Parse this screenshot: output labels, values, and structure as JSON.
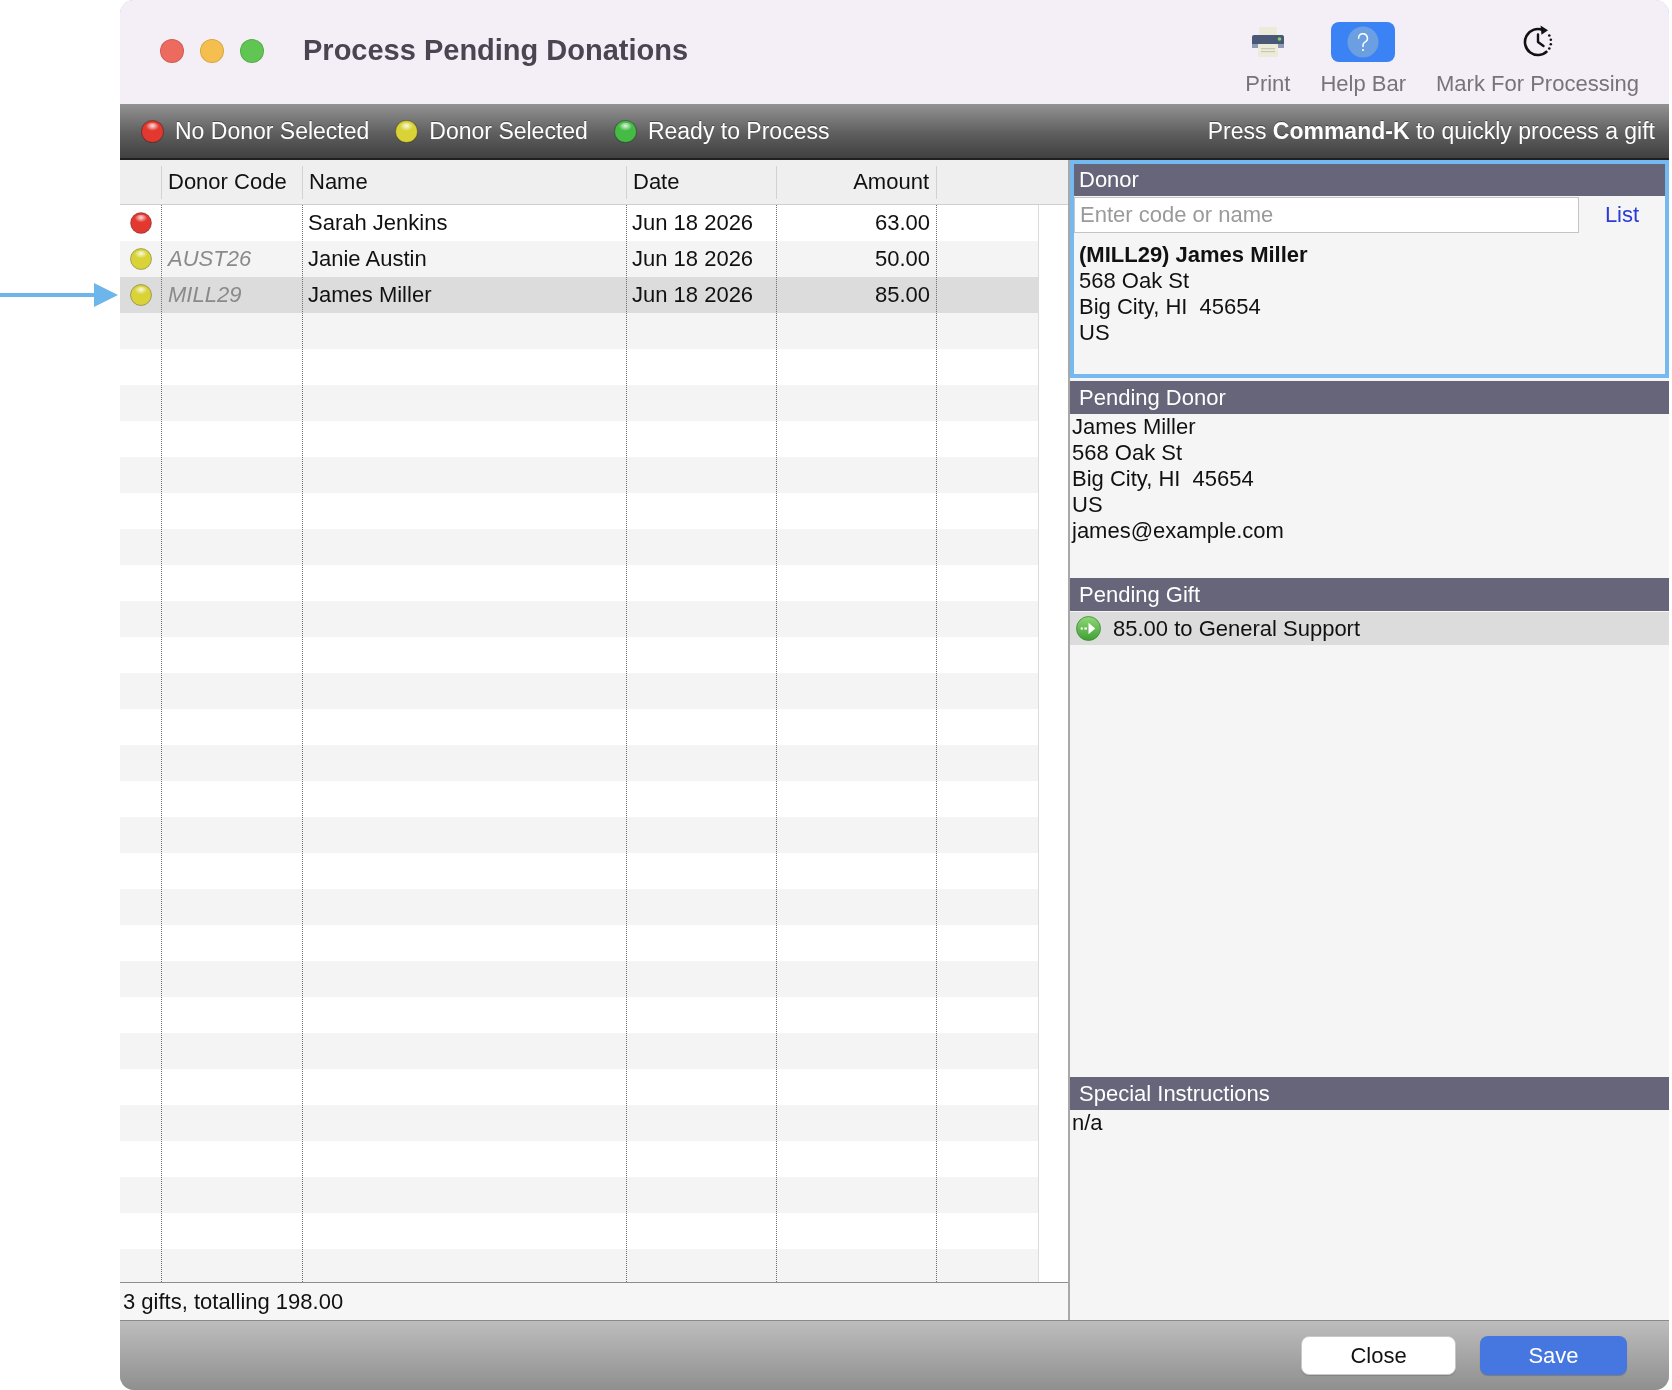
{
  "window": {
    "title": "Process Pending Donations"
  },
  "toolbar": [
    {
      "kind": "print",
      "label": "Print",
      "on": false
    },
    {
      "kind": "help",
      "label": "Help Bar",
      "on": true
    },
    {
      "kind": "clock",
      "label": "Mark For Processing",
      "on": false
    }
  ],
  "legend": {
    "items": [
      {
        "label": "No Donor Selected",
        "color": "#e2382f"
      },
      {
        "label": "Donor Selected",
        "color": "#d9d338"
      },
      {
        "label": "Ready to Process",
        "color": "#45bb45"
      }
    ],
    "hint": "Press **Command-K** to quickly process a gift"
  },
  "table": {
    "columns": [
      "Donor Code",
      "Name",
      "Date",
      "Amount"
    ],
    "rows": [
      {
        "color": "#e2382f",
        "name": "Sarah Jenkins",
        "date": "Jun 18 2026",
        "amount": "63.00",
        "selected": false
      },
      {
        "color": "#d9d338",
        "donor_code": "AUST26",
        "name": "Janie Austin",
        "date": "Jun 18 2026",
        "amount": "50.00",
        "selected": false
      },
      {
        "color": "#d9d338",
        "donor_code": "MILL29",
        "name": "James Miller",
        "date": "Jun 18 2026",
        "amount": "85.00",
        "selected": true
      }
    ],
    "summary": "3 gifts, totalling 198.00"
  },
  "donor": {
    "title": "Donor",
    "focused": true,
    "search": {
      "placeholder": "Enter code or name"
    },
    "list_link": "List",
    "match": {
      "heading": "(MILL29) James Miller",
      "lines": [
        "568 Oak St",
        "Big City, HI  45654",
        "US"
      ]
    }
  },
  "pending_donor": {
    "title": "Pending Donor",
    "lines": [
      "James Miller",
      "568 Oak St",
      "Big City, HI  45654",
      "US",
      "james@example.com"
    ]
  },
  "pending_gift": {
    "title": "Pending Gift",
    "items": [
      {
        "text": "85.00 to General Support",
        "selected": true
      }
    ]
  },
  "special_instructions": {
    "title": "Special Instructions",
    "text": "n/a"
  },
  "buttons": [
    {
      "kind": "default",
      "label": "Close"
    },
    {
      "kind": "primary",
      "label": "Save"
    }
  ]
}
